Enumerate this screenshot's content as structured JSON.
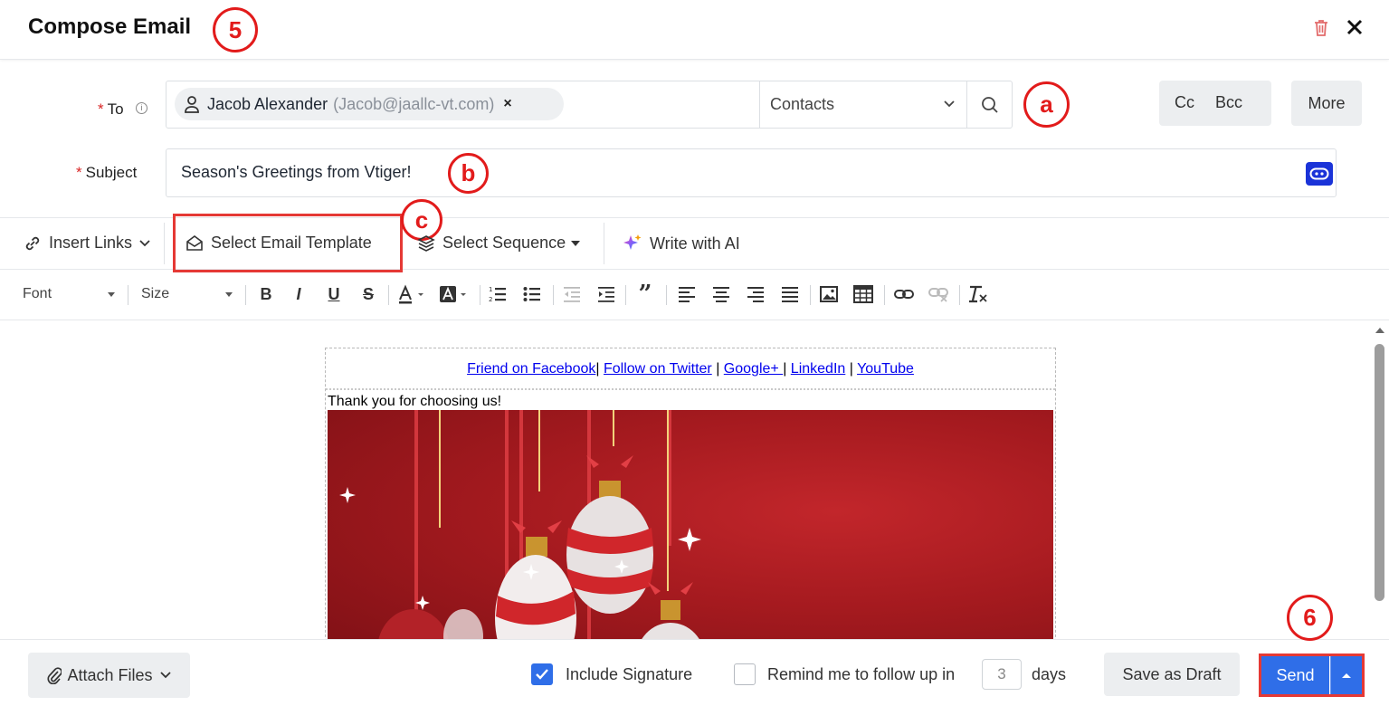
{
  "header": {
    "title": "Compose Email",
    "callout_title": "5"
  },
  "to_field": {
    "label": "To",
    "required_mark": "*",
    "info_icon": "info-icon",
    "recipient_name": "Jacob Alexander",
    "recipient_email": "(Jacob@jaallc-vt.com)",
    "remove_glyph": "×",
    "module_select": "Contacts",
    "callout": "a"
  },
  "buttons": {
    "cc": "Cc",
    "bcc": "Bcc",
    "more": "More"
  },
  "subject_field": {
    "label": "Subject",
    "required_mark": "*",
    "value": "Season's Greetings from Vtiger!",
    "callout": "b"
  },
  "toolbar": {
    "insert_links": "Insert Links",
    "select_template": "Select Email Template",
    "select_sequence": "Select Sequence",
    "write_ai": "Write with AI",
    "callout": "c"
  },
  "format_bar": {
    "font": "Font",
    "size": "Size"
  },
  "editor": {
    "social_links": {
      "facebook": "Friend on Facebook",
      "twitter": "Follow on Twitter",
      "google": "Google+ ",
      "linkedin": "LinkedIn",
      "youtube": "YouTube",
      "separator": "|"
    },
    "thanks_text": "Thank you for choosing us!"
  },
  "footer": {
    "attach": "Attach Files",
    "include_signature": "Include Signature",
    "include_signature_checked": true,
    "remind_label": "Remind me to follow up in",
    "remind_checked": false,
    "days_placeholder": "3",
    "days_label": "days",
    "save_draft": "Save as Draft",
    "send": "Send",
    "callout": "6"
  },
  "colors": {
    "accent_blue": "#2f6ee8",
    "callout_red": "#e21b1b",
    "banner_red": "#a51a1f"
  }
}
